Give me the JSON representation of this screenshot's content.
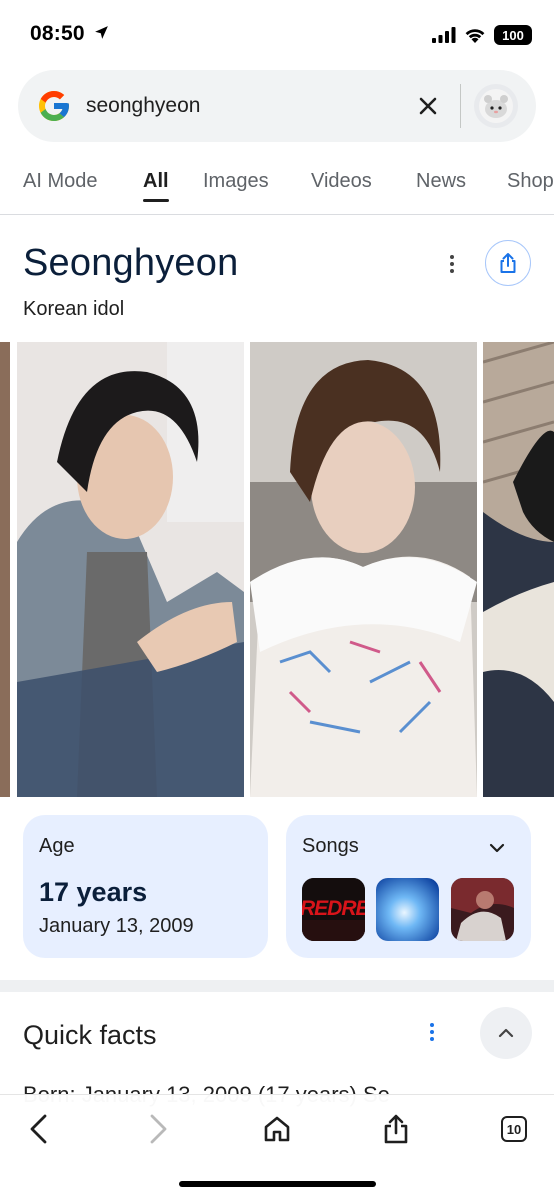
{
  "status_bar": {
    "time": "08:50",
    "battery": "100"
  },
  "search": {
    "query": "seonghyeon"
  },
  "tabs": [
    {
      "label": "AI Mode"
    },
    {
      "label": "All"
    },
    {
      "label": "Images"
    },
    {
      "label": "Videos"
    },
    {
      "label": "News"
    },
    {
      "label": "Shop"
    }
  ],
  "knowledge_panel": {
    "title": "Seonghyeon",
    "subtitle": "Korean idol"
  },
  "age_card": {
    "label": "Age",
    "value": "17 years",
    "date": "January 13, 2009"
  },
  "songs_card": {
    "label": "Songs",
    "thumbnails": [
      {
        "text": "REDRE"
      },
      {
        "text": ""
      },
      {
        "text": ""
      }
    ]
  },
  "quick_facts": {
    "title": "Quick facts",
    "peek": "Born: January 13, 2009 (17 years) Se"
  },
  "toolbar": {
    "tabs_count": "10"
  },
  "colors": {
    "card_bg": "#e7efff",
    "title": "#0b1f3a",
    "accent_blue": "#1a73e8"
  }
}
